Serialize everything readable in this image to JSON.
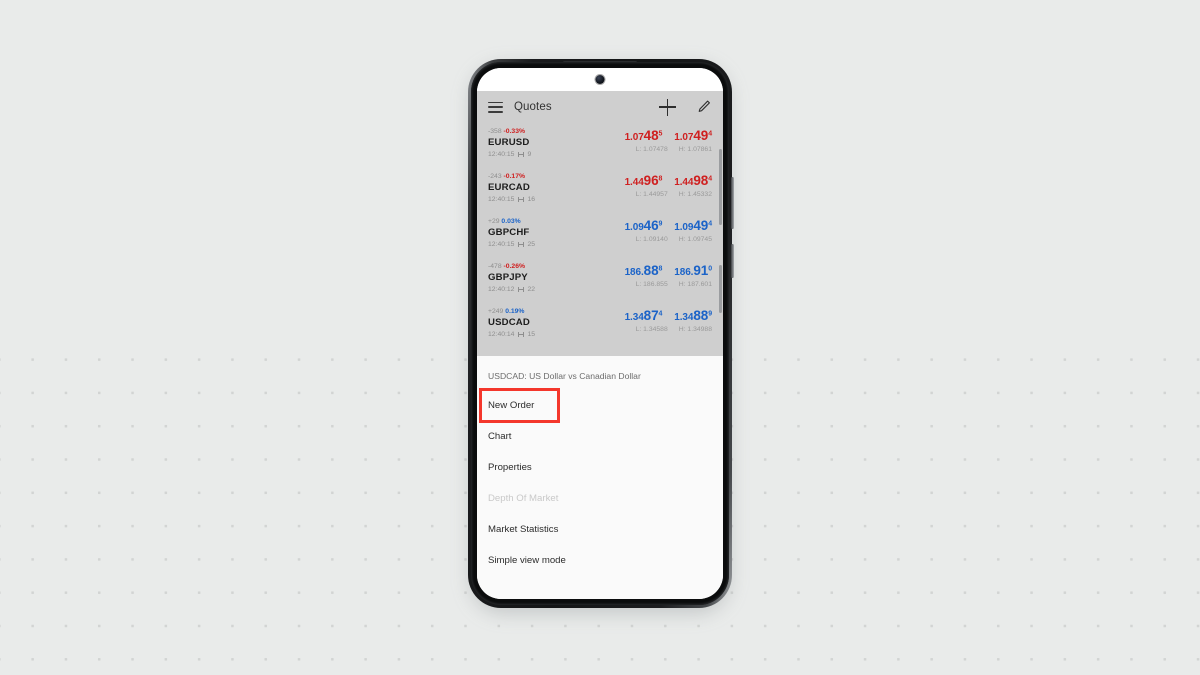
{
  "app": {
    "header": {
      "menu_icon": "hamburger-menu-icon",
      "title": "Quotes",
      "add_icon": "plus-icon",
      "edit_icon": "pencil-icon"
    },
    "quotes": [
      {
        "symbol": "EURUSD",
        "points": "-358",
        "percent": "-0.33%",
        "direction": "down",
        "time": "12:40:15",
        "spread": "9",
        "bid_base": "1.07",
        "bid_big": "48",
        "bid_sup": "5",
        "ask_base": "1.07",
        "ask_big": "49",
        "ask_sup": "4",
        "low": "L: 1.07478",
        "high": "H: 1.07861"
      },
      {
        "symbol": "EURCAD",
        "points": "-243",
        "percent": "-0.17%",
        "direction": "down",
        "time": "12:40:15",
        "spread": "16",
        "bid_base": "1.44",
        "bid_big": "96",
        "bid_sup": "8",
        "ask_base": "1.44",
        "ask_big": "98",
        "ask_sup": "4",
        "low": "L: 1.44957",
        "high": "H: 1.45332"
      },
      {
        "symbol": "GBPCHF",
        "points": "+29",
        "percent": "0.03%",
        "direction": "up",
        "time": "12:40:15",
        "spread": "25",
        "bid_base": "1.09",
        "bid_big": "46",
        "bid_sup": "9",
        "ask_base": "1.09",
        "ask_big": "49",
        "ask_sup": "4",
        "low": "L: 1.09140",
        "high": "H: 1.09745"
      },
      {
        "symbol": "GBPJPY",
        "points": "-478",
        "percent": "-0.26%",
        "direction": "up",
        "time": "12:40:12",
        "spread": "22",
        "bid_base": "186.",
        "bid_big": "88",
        "bid_sup": "8",
        "ask_base": "186.",
        "ask_big": "91",
        "ask_sup": "0",
        "low": "L: 186.855",
        "high": "H: 187.601"
      },
      {
        "symbol": "USDCAD",
        "points": "+249",
        "percent": "0.19%",
        "direction": "up",
        "time": "12:40:14",
        "spread": "15",
        "bid_base": "1.34",
        "bid_big": "87",
        "bid_sup": "4",
        "ask_base": "1.34",
        "ask_big": "88",
        "ask_sup": "9",
        "low": "L: 1.34588",
        "high": "H: 1.34988"
      }
    ],
    "sheet": {
      "title": "USDCAD: US Dollar vs Canadian Dollar",
      "items": [
        {
          "label": "New Order",
          "state": "highlighted"
        },
        {
          "label": "Chart",
          "state": "normal"
        },
        {
          "label": "Properties",
          "state": "normal"
        },
        {
          "label": "Depth Of Market",
          "state": "disabled"
        },
        {
          "label": "Market Statistics",
          "state": "normal"
        },
        {
          "label": "Simple view mode",
          "state": "normal"
        }
      ]
    }
  },
  "colors": {
    "background": "#e9ebea",
    "header_bar": "#cfcfcf",
    "price_down": "#cf2020",
    "price_up": "#1b63c8",
    "highlight_box": "#f4372c",
    "sheet_background": "#fafafa"
  }
}
